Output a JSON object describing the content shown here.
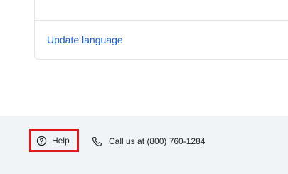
{
  "settings_card": {
    "update_language_label": "Update language"
  },
  "footer": {
    "help_label": "Help",
    "help_icon": "question-circle-icon",
    "phone_icon": "phone-icon",
    "call_text": "Call us at (800) 760-1284"
  },
  "colors": {
    "link": "#1a5fd1",
    "highlight_border": "#e0161d",
    "footer_bg": "#f1f4f7"
  }
}
